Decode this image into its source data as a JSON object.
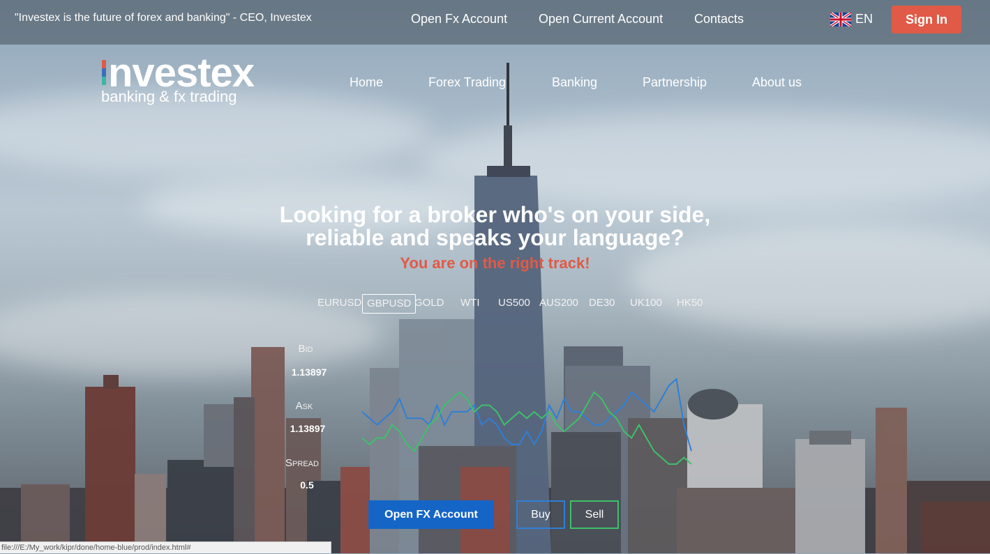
{
  "topbar": {
    "quote": "\"Investex is the future of forex and banking\" - CEO, Investex",
    "links": [
      "Open Fx Account",
      "Open Current Account",
      "Contacts"
    ],
    "language": "EN",
    "signin": "Sign In"
  },
  "logo": {
    "name": "nvestex",
    "tagline": "banking & fx trading"
  },
  "nav": [
    "Home",
    "Forex Trading",
    "Banking",
    "Partnership",
    "About us"
  ],
  "hero": {
    "line1": "Looking for a broker who's on your side,",
    "line2": "reliable and speaks your language?",
    "subtitle": "You are on the right track!"
  },
  "instruments": [
    "EURUSD",
    "GBPUSD",
    "GOLD",
    "WTI",
    "US500",
    "AUS200",
    "DE30",
    "UK100",
    "HK50"
  ],
  "selected_instrument": "GBPUSD",
  "quote_panel": {
    "bid_label": "Bid",
    "bid_value": "1.13897",
    "ask_label": "Ask",
    "ask_value": "1.13897",
    "spread_label": "Spread",
    "spread_value": "0.5"
  },
  "chart_data": {
    "type": "line",
    "series": [
      {
        "color": "#2f7fd6",
        "values": [
          6,
          5,
          4,
          5,
          6,
          8,
          5,
          5,
          5,
          4,
          7,
          4,
          6,
          6,
          6,
          7,
          4,
          5,
          4,
          2,
          1,
          1,
          3,
          1,
          3,
          7,
          5,
          8,
          6,
          6,
          5,
          4,
          4,
          5,
          6,
          7,
          9,
          8,
          7,
          6,
          8,
          10,
          11,
          4,
          0
        ]
      },
      {
        "color": "#3fc06a",
        "values": [
          2,
          1,
          2,
          2,
          4,
          3,
          1,
          0,
          2,
          4,
          5,
          7,
          8,
          9,
          8,
          6,
          7,
          7,
          6,
          4,
          5,
          6,
          5,
          6,
          5,
          6,
          4,
          3,
          4,
          5,
          7,
          9,
          8,
          6,
          5,
          3,
          2,
          4,
          2,
          0,
          -1,
          -2,
          -2,
          -1,
          -2
        ]
      }
    ]
  },
  "buttons": {
    "open": "Open FX Account",
    "buy": "Buy",
    "sell": "Sell"
  },
  "statusbar": "file:///E:/My_work/kipr/done/home-blue/prod/index.html#",
  "colors": {
    "accent": "#e05a47",
    "primary": "#1565c7",
    "buy": "#2f7fd6",
    "sell": "#3fc06a"
  }
}
